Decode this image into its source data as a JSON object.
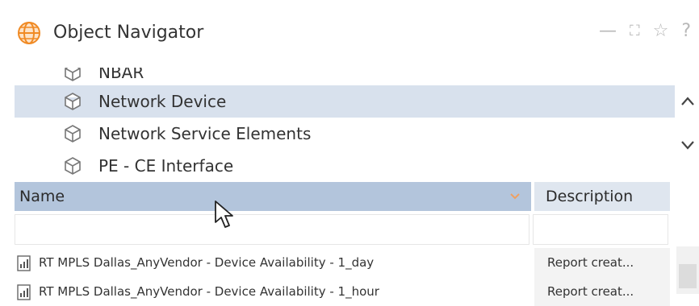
{
  "window": {
    "title": "Object Navigator",
    "controls": {
      "minimize": "—",
      "maximize": "⛶",
      "favorite": "☆",
      "help": "?"
    }
  },
  "tree": {
    "items": [
      {
        "label": "NBAR",
        "selected": false,
        "partial": true
      },
      {
        "label": "Network Device",
        "selected": true
      },
      {
        "label": "Network Service Elements",
        "selected": false
      },
      {
        "label": "PE - CE Interface",
        "selected": false
      }
    ],
    "scroll_up": "^",
    "scroll_down": "v"
  },
  "grid": {
    "columns": [
      {
        "label": "Name",
        "sorted": true
      },
      {
        "label": "Description"
      }
    ],
    "filter": {
      "name_value": "",
      "description_value": ""
    },
    "rows": [
      {
        "name": "RT MPLS Dallas_AnyVendor - Device Availability - 1_day",
        "description": "Report creat..."
      },
      {
        "name": "RT MPLS Dallas_AnyVendor - Device Availability - 1_hour",
        "description": "Report creat..."
      }
    ]
  },
  "colors": {
    "selected_row": "#d8e1ed",
    "header_name": "#b3c5dc",
    "header_desc": "#dfe6ef",
    "globe": "#f08a24"
  }
}
